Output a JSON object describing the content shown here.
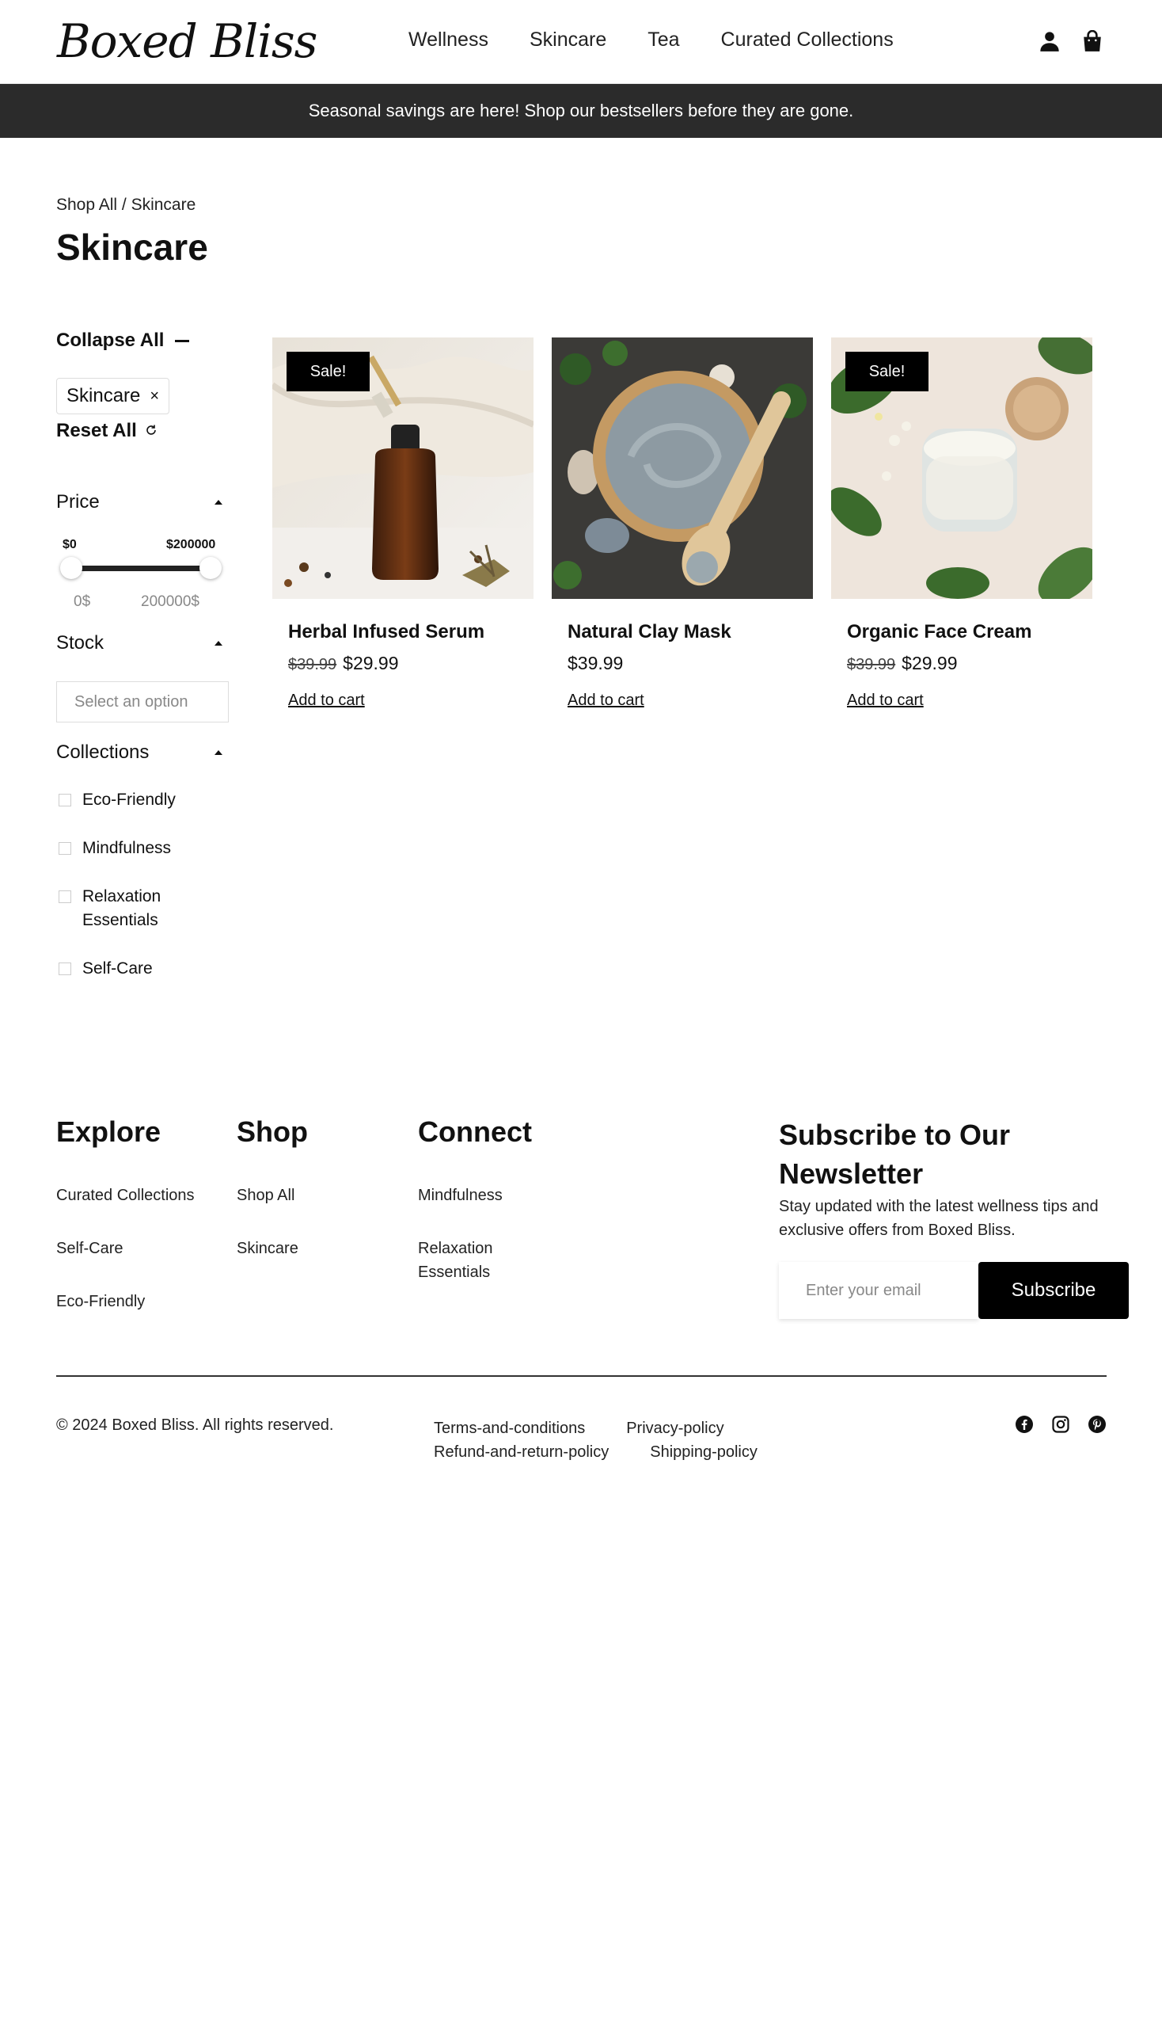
{
  "brand": {
    "logo": "Boxed Bliss"
  },
  "nav": {
    "items": [
      "Wellness",
      "Skincare",
      "Tea",
      "Curated Collections"
    ]
  },
  "header_icons": [
    "account-icon",
    "bag-icon"
  ],
  "announcement": "Seasonal savings are here! Shop our bestsellers before they are gone.",
  "breadcrumb": {
    "parent": "Shop All",
    "separator": " / ",
    "current": "Skincare"
  },
  "page_title": "Skincare",
  "sidebar": {
    "collapse_all": "Collapse All",
    "active_filter": "Skincare",
    "remove_symbol": "×",
    "reset_all": "Reset All",
    "price": {
      "label": "Price",
      "min_label": "$0",
      "max_label": "$200000",
      "min_value": "0$",
      "max_value": "200000$",
      "min_fraction": 0,
      "max_fraction": 1
    },
    "stock": {
      "label": "Stock",
      "placeholder": "Select an option"
    },
    "collections": {
      "label": "Collections",
      "options": [
        "Eco-Friendly",
        "Mindfulness",
        "Relaxation Essentials",
        "Self-Care"
      ]
    }
  },
  "products": [
    {
      "name": "Herbal Infused Serum",
      "badge": "Sale!",
      "old_price": "$39.99",
      "price": "$29.99",
      "cta": "Add to cart"
    },
    {
      "name": "Natural Clay Mask",
      "badge": "",
      "old_price": "",
      "price": "$39.99",
      "cta": "Add to cart"
    },
    {
      "name": "Organic Face Cream",
      "badge": "Sale!",
      "old_price": "$39.99",
      "price": "$29.99",
      "cta": "Add to cart"
    }
  ],
  "footer": {
    "explore": {
      "title": "Explore",
      "links": [
        "Curated Collections",
        "Self-Care",
        "Eco-Friendly"
      ]
    },
    "shop": {
      "title": "Shop",
      "links": [
        "Shop All",
        "Skincare"
      ]
    },
    "connect": {
      "title": "Connect",
      "links": [
        "Mindfulness",
        "Relaxation Essentials"
      ]
    },
    "newsletter": {
      "title": "Subscribe to Our Newsletter",
      "text": "Stay updated with the latest wellness tips and exclusive offers from Boxed Bliss.",
      "placeholder": "Enter your email",
      "button": "Subscribe"
    },
    "copyright": "© 2024 Boxed Bliss. All rights reserved.",
    "legal": [
      "Terms-and-conditions",
      "Privacy-policy",
      "Refund-and-return-policy",
      "Shipping-policy"
    ],
    "social": [
      "facebook-icon",
      "instagram-icon",
      "pinterest-icon"
    ]
  }
}
